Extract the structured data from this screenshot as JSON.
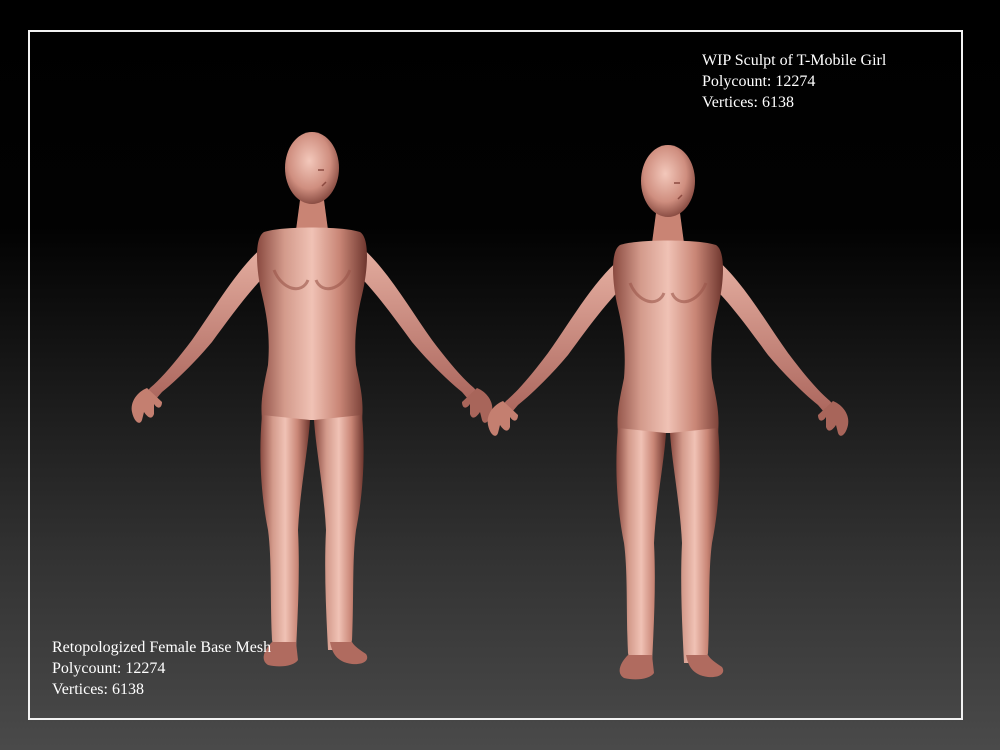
{
  "sculpt_caption": {
    "title": "WIP Sculpt of T-Mobile Girl",
    "polycount": "Polycount: 12274",
    "vertices": "Vertices: 6138"
  },
  "basemesh_caption": {
    "title": "Retopologized Female Base Mesh",
    "polycount": "Polycount: 12274",
    "vertices": "Vertices: 6138"
  },
  "colors": {
    "frame": "#f2f2f2",
    "caption_text": "#ffffff",
    "skin_light": "#e8b3a5",
    "skin_mid": "#c98878",
    "skin_dark": "#7a3f36"
  }
}
